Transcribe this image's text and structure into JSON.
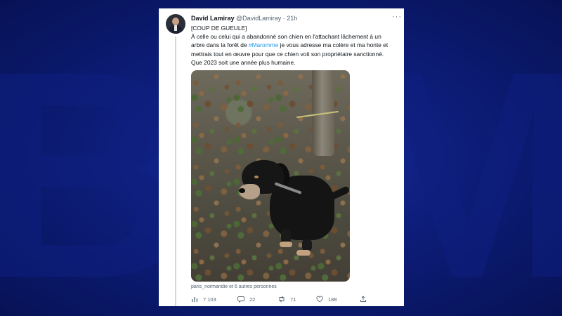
{
  "tweet": {
    "author_name": "David Lamiray",
    "author_handle": "@DavidLamiray",
    "separator": "·",
    "time": "21h",
    "more_label": "···",
    "lines": {
      "l1": "[COUP DE GUEULE]",
      "l2": "À celle ou celui qui a abandonné son chien en l'attachant lâchement à un",
      "l3a": "arbre dans la forêt de ",
      "hashtag": "#Maromme",
      "l3b": " je vous adresse ma colère et ma honte et",
      "l4": "mettrais tout en œuvre pour que ce chien voit son propriétaire sanctionné.",
      "l5": "Que 2023 soit une année plus humaine."
    },
    "liked_by": "paris_normandie et 6 autres personnes",
    "stats": {
      "views": "7 103",
      "replies": "22",
      "retweets": "71",
      "likes": "188"
    }
  },
  "colors": {
    "background": "#0b1a6e",
    "link": "#1d9bf0",
    "secondary_text": "#536471"
  },
  "background_logo": "BFM",
  "icons": [
    "views-icon",
    "reply-icon",
    "retweet-icon",
    "like-icon",
    "share-icon"
  ]
}
